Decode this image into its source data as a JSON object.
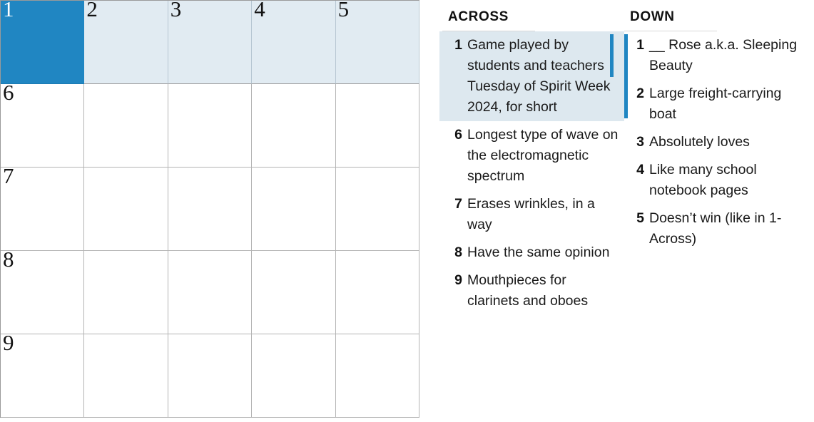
{
  "grid": {
    "rows": 5,
    "cols": 5,
    "selected_cell_color": "#2086c2",
    "highlight_row_color": "#e1ebf2",
    "cells": [
      [
        {
          "number": "1",
          "letter": "",
          "state": "selected"
        },
        {
          "number": "2",
          "letter": "",
          "state": "highlight"
        },
        {
          "number": "3",
          "letter": "",
          "state": "highlight"
        },
        {
          "number": "4",
          "letter": "",
          "state": "highlight"
        },
        {
          "number": "5",
          "letter": "",
          "state": "highlight"
        }
      ],
      [
        {
          "number": "6",
          "letter": "",
          "state": "normal"
        },
        {
          "number": "",
          "letter": "",
          "state": "normal"
        },
        {
          "number": "",
          "letter": "",
          "state": "normal"
        },
        {
          "number": "",
          "letter": "",
          "state": "normal"
        },
        {
          "number": "",
          "letter": "",
          "state": "normal"
        }
      ],
      [
        {
          "number": "7",
          "letter": "",
          "state": "normal"
        },
        {
          "number": "",
          "letter": "",
          "state": "normal"
        },
        {
          "number": "",
          "letter": "",
          "state": "normal"
        },
        {
          "number": "",
          "letter": "",
          "state": "normal"
        },
        {
          "number": "",
          "letter": "",
          "state": "normal"
        }
      ],
      [
        {
          "number": "8",
          "letter": "",
          "state": "normal"
        },
        {
          "number": "",
          "letter": "",
          "state": "normal"
        },
        {
          "number": "",
          "letter": "",
          "state": "normal"
        },
        {
          "number": "",
          "letter": "",
          "state": "normal"
        },
        {
          "number": "",
          "letter": "",
          "state": "normal"
        }
      ],
      [
        {
          "number": "9",
          "letter": "",
          "state": "normal"
        },
        {
          "number": "",
          "letter": "",
          "state": "normal"
        },
        {
          "number": "",
          "letter": "",
          "state": "normal"
        },
        {
          "number": "",
          "letter": "",
          "state": "normal"
        },
        {
          "number": "",
          "letter": "",
          "state": "normal"
        }
      ]
    ]
  },
  "across": {
    "heading": "ACROSS",
    "clues": [
      {
        "number": "1",
        "text": "Game played by students and teachers Tuesday of Spirit Week 2024, for short",
        "active": true
      },
      {
        "number": "6",
        "text": "Longest type of wave on the electromagnetic spectrum",
        "active": false
      },
      {
        "number": "7",
        "text": "Erases wrinkles, in a way",
        "active": false
      },
      {
        "number": "8",
        "text": "Have the same opinion",
        "active": false
      },
      {
        "number": "9",
        "text": "Mouthpieces for clarinets and oboes",
        "active": false
      }
    ]
  },
  "down": {
    "heading": "DOWN",
    "clues": [
      {
        "number": "1",
        "text": "__ Rose a.k.a. Sleeping Beauty",
        "active": true
      },
      {
        "number": "2",
        "text": "Large freight-carrying boat",
        "active": false
      },
      {
        "number": "3",
        "text": "Absolutely loves",
        "active": false
      },
      {
        "number": "4",
        "text": "Like many school notebook pages",
        "active": false
      },
      {
        "number": "5",
        "text": "Doesn’t win (like in 1-Across)",
        "active": false
      }
    ]
  }
}
